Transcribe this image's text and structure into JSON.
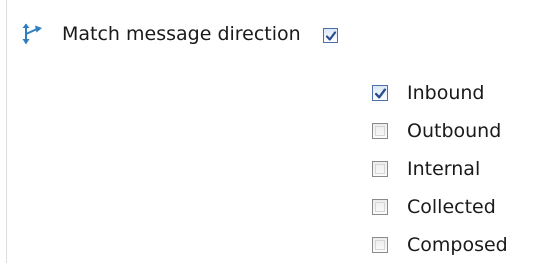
{
  "match_direction": {
    "label": "Match message direction",
    "checked": true,
    "icon": "direction-arrows-icon",
    "icon_color": "#2f7ec1"
  },
  "directions": [
    {
      "label": "Inbound",
      "checked": true
    },
    {
      "label": "Outbound",
      "checked": false
    },
    {
      "label": "Internal",
      "checked": false
    },
    {
      "label": "Collected",
      "checked": false
    },
    {
      "label": "Composed",
      "checked": false
    }
  ]
}
